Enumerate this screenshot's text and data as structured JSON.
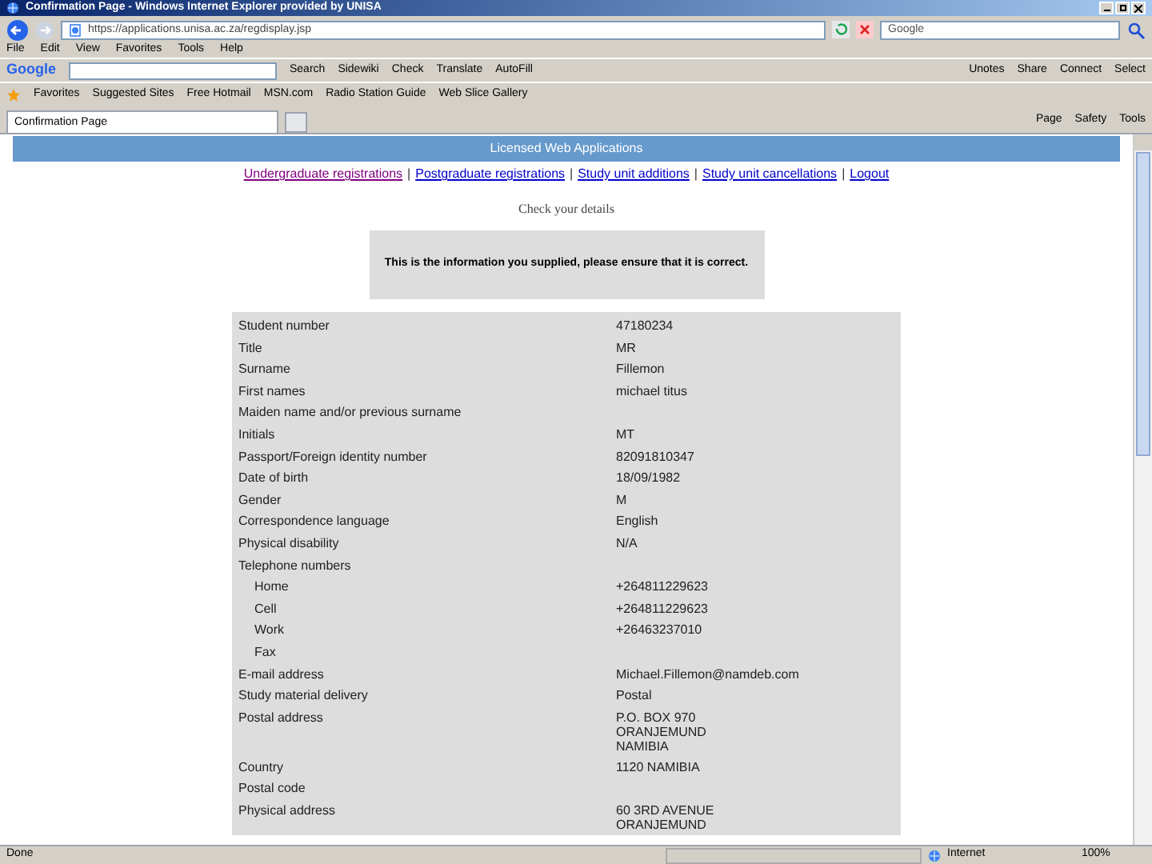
{
  "window": {
    "title": "Confirmation Page - Windows Internet Explorer provided by UNISA"
  },
  "address_bar": {
    "url": "https://applications.unisa.ac.za/regdisplay.jsp",
    "search_placeholder": "Google"
  },
  "menu": [
    "File",
    "Edit",
    "View",
    "Favorites",
    "Tools",
    "Help"
  ],
  "google_toolbar": {
    "logo": "Google",
    "buttons": [
      "Search",
      "Sidewiki",
      "Check",
      "Translate",
      "AutoFill"
    ],
    "right_buttons": [
      "Unotes",
      "Share",
      "Connect",
      "Select"
    ]
  },
  "favorites_bar": {
    "label": "Favorites",
    "items": [
      "Suggested Sites",
      "Free Hotmail",
      "MSN.com",
      "Radio Station Guide",
      "Web Slice Gallery"
    ]
  },
  "tabs": [
    {
      "label": "Confirmation Page",
      "selected": true
    }
  ],
  "command_bar": [
    "Page",
    "Safety",
    "Tools"
  ],
  "page": {
    "banner": "Licensed Web Applications",
    "nav_separator": "|",
    "nav_links": [
      "Undergraduate registrations",
      "Postgraduate registrations",
      "Study unit additions",
      "Study unit cancellations",
      "Logout"
    ],
    "heading": "Check your details",
    "notice": "This is the information you supplied, please ensure that it is correct.",
    "rows": [
      {
        "label": "Student number",
        "value": "47180234"
      },
      {
        "label": "Title",
        "value": "MR"
      },
      {
        "label": "Surname",
        "value": "Fillemon"
      },
      {
        "label": "First names",
        "value": "michael titus"
      },
      {
        "label": "Maiden name and/or previous surname"
      },
      {
        "label": "Initials",
        "value": "MT"
      },
      {
        "label": "Passport/Foreign identity number",
        "value": "82091810347"
      },
      {
        "label": "Date of birth",
        "value": "18/09/1982"
      },
      {
        "label": "Gender",
        "value": "M"
      },
      {
        "label": "Correspondence language",
        "value": "English"
      },
      {
        "label": "Physical disability",
        "value": "N/A"
      },
      {
        "label": "Telephone numbers",
        "children": [
          {
            "label": "Home",
            "value": "+264811229623"
          },
          {
            "label": "Cell",
            "value": "+264811229623"
          },
          {
            "label": "Work",
            "value": "+26463237010"
          },
          {
            "label": "Fax"
          }
        ]
      },
      {
        "label": "E-mail address",
        "value": "Michael.Fillemon@namdeb.com"
      },
      {
        "label": "Study material delivery",
        "value": "Postal"
      },
      {
        "label": "Postal address",
        "lines": [
          "P.O. BOX 970",
          "ORANJEMUND",
          "NAMIBIA"
        ]
      },
      {
        "label": "Country",
        "value": "1120 NAMIBIA"
      },
      {
        "label": "Postal code"
      },
      {
        "label": "Physical address",
        "lines": [
          "60 3RD AVENUE",
          "ORANJEMUND"
        ]
      }
    ]
  },
  "status_bar": {
    "text": "Done",
    "zone": "Internet",
    "zoom": "100%"
  }
}
